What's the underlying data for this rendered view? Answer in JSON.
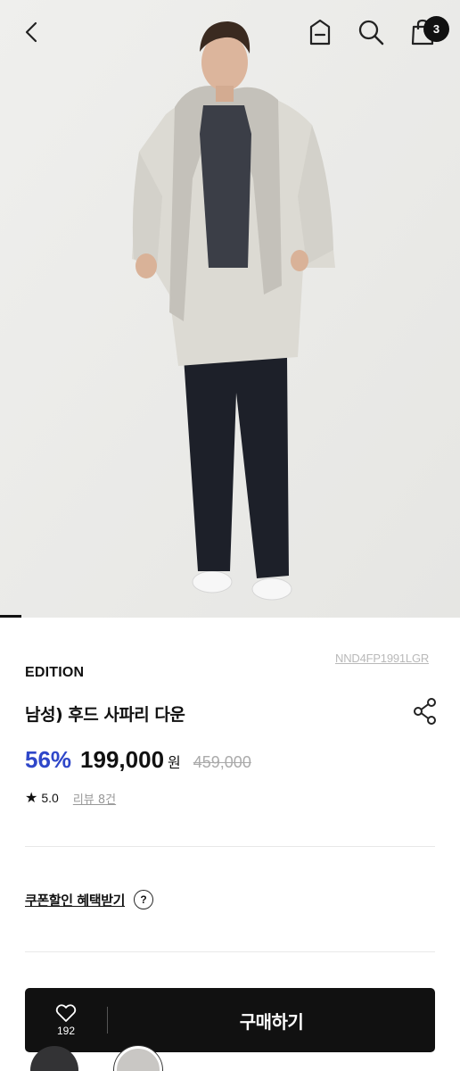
{
  "header": {
    "cart_count": "3"
  },
  "icons": {
    "back": "chevron-left-icon",
    "menu": "menu-box-icon",
    "search": "search-icon",
    "cart": "shopping-bag-icon",
    "share": "share-icon",
    "wish": "heart-icon",
    "rating": "star-icon"
  },
  "product": {
    "sku": "NND4FP1991LGR",
    "brand": "EDITION",
    "name": "남성) 후드 사파리 다운",
    "discount": "56%",
    "sale_price": "199,000",
    "currency": "원",
    "original_price": "459,000",
    "star": "★",
    "rating": "5.0",
    "reviews": "리뷰 8건"
  },
  "coupon": {
    "label": "쿠폰할인 혜택받기",
    "help": "?"
  },
  "purchase": {
    "wish_count": "192",
    "buy_label": "구매하기"
  },
  "colors": {
    "discount": "#2f47c9",
    "bar": "#111111",
    "coat": "#dcdad3",
    "swatch_dark": "#333335",
    "swatch_light": "#c9c7c4"
  }
}
